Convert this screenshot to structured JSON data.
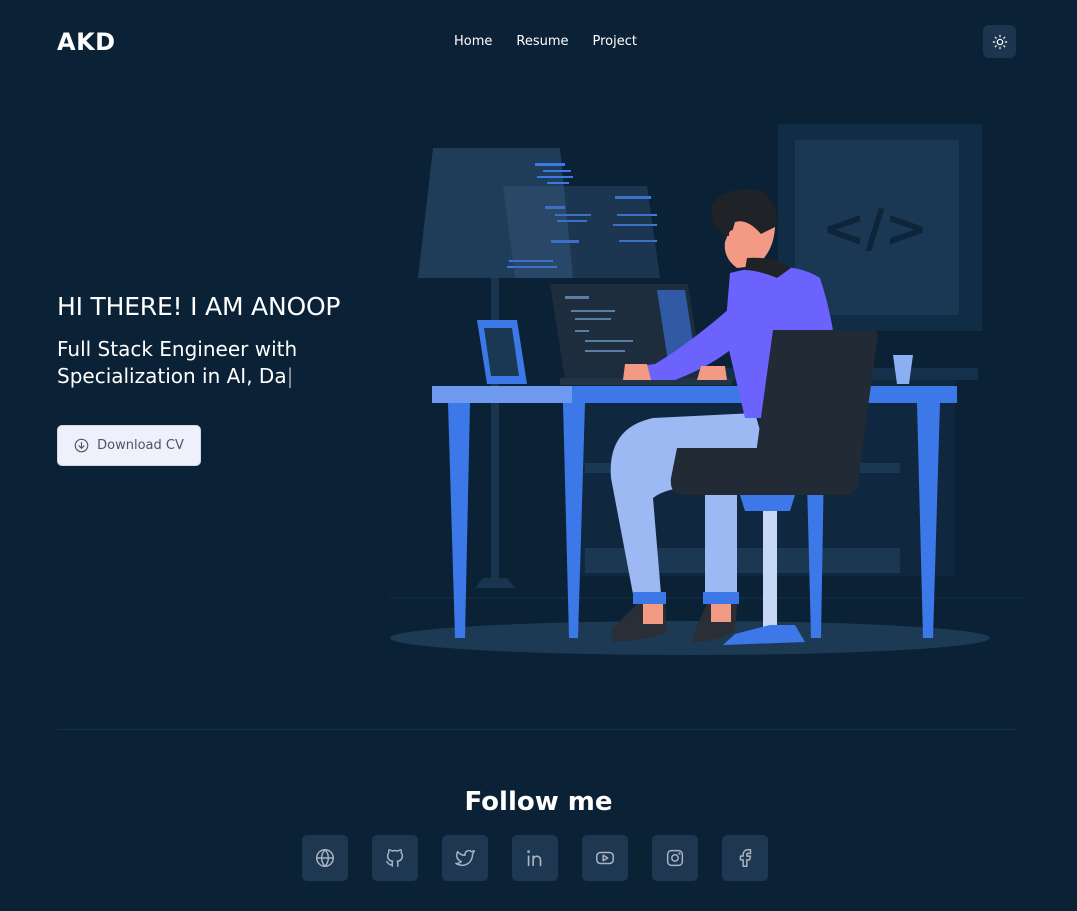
{
  "header": {
    "logo": "AKD",
    "nav": [
      {
        "label": "Home"
      },
      {
        "label": "Resume"
      },
      {
        "label": "Project"
      }
    ],
    "theme_toggle_icon": "sun-icon"
  },
  "hero": {
    "title": "HI THERE! I AM ANOOP",
    "subtitle": "Full Stack Engineer with Specialization in AI, Da",
    "cursor": "|",
    "download_label": "Download CV",
    "download_icon": "download-circle-icon",
    "illustration_code_tag": "</>"
  },
  "follow": {
    "title": "Follow me",
    "icons": [
      "globe-icon",
      "github-icon",
      "twitter-icon",
      "linkedin-icon",
      "youtube-icon",
      "instagram-icon",
      "facebook-icon"
    ]
  },
  "colors": {
    "background": "#0b2136",
    "accent_blue": "#3c78e8",
    "purple": "#6c63ff",
    "button_bg": "#eef1fb",
    "social_bg": "#1f3852"
  }
}
